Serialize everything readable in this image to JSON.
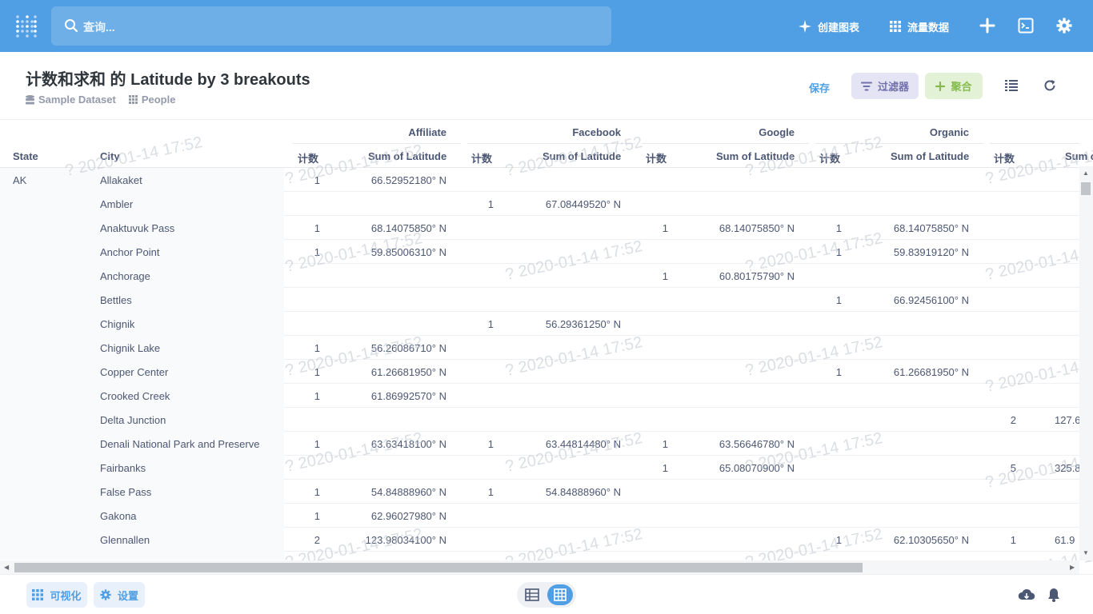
{
  "nav": {
    "search_placeholder": "查询...",
    "create_chart": "创建图表",
    "traffic_data": "流量数据"
  },
  "header": {
    "title": "计数和求和 的 Latitude by 3 breakouts",
    "database": "Sample Dataset",
    "table": "People",
    "save": "保存",
    "filter": "过滤器",
    "aggregate": "聚合"
  },
  "table": {
    "left_headers": [
      "State",
      "City"
    ],
    "groups": [
      "Affiliate",
      "Facebook",
      "Google",
      "Organic"
    ],
    "count_label": "计数",
    "sum_label": "Sum of Latitude",
    "partial_sum_label": "Sum o",
    "watermark": "? 2020-01-14 17:52",
    "rows": [
      {
        "state": "AK",
        "city": "Allakaket",
        "c": [
          "1",
          "66.52952180° N",
          "",
          "",
          "",
          "",
          "",
          "",
          "",
          ""
        ]
      },
      {
        "state": "",
        "city": "Ambler",
        "c": [
          "",
          "",
          "1",
          "67.08449520° N",
          "",
          "",
          "",
          "",
          "",
          ""
        ]
      },
      {
        "state": "",
        "city": "Anaktuvuk Pass",
        "c": [
          "1",
          "68.14075850° N",
          "",
          "",
          "1",
          "68.14075850° N",
          "1",
          "68.14075850° N",
          "",
          ""
        ]
      },
      {
        "state": "",
        "city": "Anchor Point",
        "c": [
          "1",
          "59.85006310° N",
          "",
          "",
          "",
          "",
          "1",
          "59.83919120° N",
          "",
          ""
        ]
      },
      {
        "state": "",
        "city": "Anchorage",
        "c": [
          "",
          "",
          "",
          "",
          "1",
          "60.80175790° N",
          "",
          "",
          "",
          ""
        ]
      },
      {
        "state": "",
        "city": "Bettles",
        "c": [
          "",
          "",
          "",
          "",
          "",
          "",
          "1",
          "66.92456100° N",
          "",
          ""
        ]
      },
      {
        "state": "",
        "city": "Chignik",
        "c": [
          "",
          "",
          "1",
          "56.29361250° N",
          "",
          "",
          "",
          "",
          "",
          ""
        ]
      },
      {
        "state": "",
        "city": "Chignik Lake",
        "c": [
          "1",
          "56.26086710° N",
          "",
          "",
          "",
          "",
          "",
          "",
          "",
          ""
        ]
      },
      {
        "state": "",
        "city": "Copper Center",
        "c": [
          "1",
          "61.26681950° N",
          "",
          "",
          "",
          "",
          "1",
          "61.26681950° N",
          "",
          ""
        ]
      },
      {
        "state": "",
        "city": "Crooked Creek",
        "c": [
          "1",
          "61.86992570° N",
          "",
          "",
          "",
          "",
          "",
          "",
          "",
          ""
        ]
      },
      {
        "state": "",
        "city": "Delta Junction",
        "c": [
          "",
          "",
          "",
          "",
          "",
          "",
          "",
          "",
          "2",
          "127.6"
        ]
      },
      {
        "state": "",
        "city": "Denali National Park and Preserve",
        "c": [
          "1",
          "63.63418100° N",
          "1",
          "63.44814480° N",
          "1",
          "63.56646780° N",
          "",
          "",
          "",
          ""
        ]
      },
      {
        "state": "",
        "city": "Fairbanks",
        "c": [
          "",
          "",
          "",
          "",
          "1",
          "65.08070900° N",
          "",
          "",
          "5",
          "325.8"
        ]
      },
      {
        "state": "",
        "city": "False Pass",
        "c": [
          "1",
          "54.84888960° N",
          "1",
          "54.84888960° N",
          "",
          "",
          "",
          "",
          "",
          ""
        ]
      },
      {
        "state": "",
        "city": "Gakona",
        "c": [
          "1",
          "62.96027980° N",
          "",
          "",
          "",
          "",
          "",
          "",
          "",
          ""
        ]
      },
      {
        "state": "",
        "city": "Glennallen",
        "c": [
          "2",
          "123.98034100° N",
          "",
          "",
          "",
          "",
          "1",
          "62.10305650° N",
          "1",
          "61.9"
        ]
      }
    ]
  },
  "footer": {
    "visualize": "可视化",
    "settings": "设置"
  }
}
